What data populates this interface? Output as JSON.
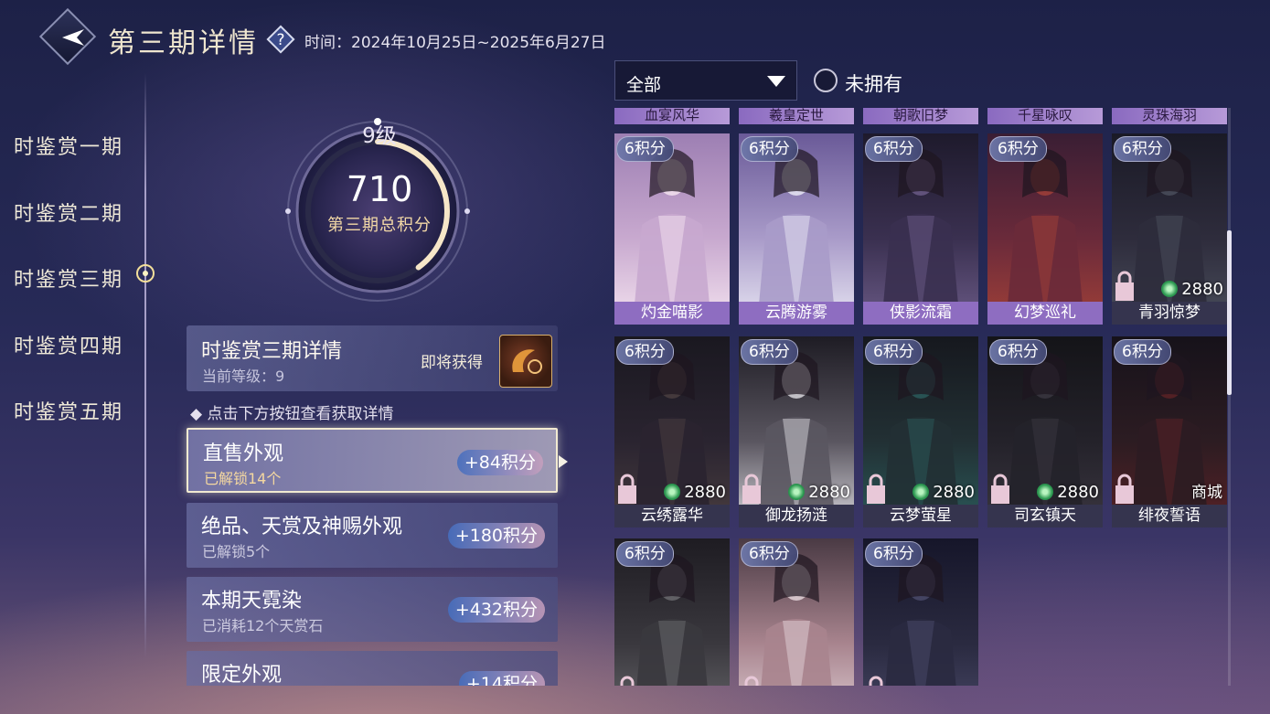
{
  "header": {
    "title": "第三期详情",
    "time_text": "时间：2024年10月25日~2025年6月27日"
  },
  "sidebar": {
    "items": [
      {
        "label": "时鉴赏一期"
      },
      {
        "label": "时鉴赏二期"
      },
      {
        "label": "时鉴赏三期",
        "active": true
      },
      {
        "label": "时鉴赏四期"
      },
      {
        "label": "时鉴赏五期"
      }
    ]
  },
  "progress": {
    "level": "9级",
    "score": "710",
    "label": "第三期总积分",
    "ring_fill_fraction": 0.4
  },
  "detail": {
    "title": "时鉴赏三期详情",
    "current_level": "当前等级：9",
    "soon_label": "即将获得",
    "hint": "◆ 点击下方按钮查看获取详情"
  },
  "rows": [
    {
      "title": "直售外观",
      "sub": "已解锁14个",
      "points": "+84积分",
      "selected": true
    },
    {
      "title": "绝品、天赏及神赐外观",
      "sub": "已解锁5个",
      "points": "+180积分"
    },
    {
      "title": "本期天霓染",
      "sub": "已消耗12个天赏石",
      "points": "+432积分"
    },
    {
      "title": "限定外观",
      "sub": "",
      "points": "+14积分"
    }
  ],
  "filter": {
    "selected": "全部",
    "owned_label": "未拥有"
  },
  "partial_top_row": [
    "血宴风华",
    "羲皇定世",
    "朝歌旧梦",
    "千星咏叹",
    "灵珠海羽"
  ],
  "cards": [
    {
      "name": "灼金喵影",
      "points": "6积分",
      "price": "",
      "shop": "",
      "palette": [
        "#f3e2ef",
        "#c8a9cf",
        "#9d7fb3"
      ],
      "bar": "#8e6dc1"
    },
    {
      "name": "云腾游雾",
      "points": "6积分",
      "price": "",
      "shop": "",
      "palette": [
        "#e8e6f3",
        "#a99bc9",
        "#6a5a98"
      ],
      "bar": "#8e6dc1"
    },
    {
      "name": "侠影流霜",
      "points": "6积分",
      "price": "",
      "shop": "",
      "palette": [
        "#6a5a86",
        "#3a3050",
        "#1e1a2c"
      ],
      "bar": "#8e6dc1"
    },
    {
      "name": "幻梦巡礼",
      "points": "6积分",
      "price": "",
      "shop": "",
      "palette": [
        "#a04038",
        "#6a2a3a",
        "#3a1e34"
      ],
      "bar": "#8e6dc1"
    },
    {
      "name": "青羽惊梦",
      "points": "6积分",
      "price": "2880",
      "shop": "",
      "palette": [
        "#4a4e5c",
        "#2e2c3c",
        "#1a1a26"
      ],
      "bar": "#35344e"
    },
    {
      "name": "云绣露华",
      "points": "6积分",
      "price": "2880",
      "shop": "",
      "palette": [
        "#4a3e40",
        "#2a2430",
        "#1a1820"
      ],
      "bar": "#35344e"
    },
    {
      "name": "御龙扬涟",
      "points": "6积分",
      "price": "2880",
      "shop": "",
      "palette": [
        "#d8d6dc",
        "#5a5660",
        "#1e1c24"
      ],
      "bar": "#35344e"
    },
    {
      "name": "云梦萤星",
      "points": "6积分",
      "price": "2880",
      "shop": "",
      "palette": [
        "#2a5a5a",
        "#223034",
        "#16181e"
      ],
      "bar": "#35344e"
    },
    {
      "name": "司玄镇天",
      "points": "6积分",
      "price": "2880",
      "shop": "",
      "palette": [
        "#3a3640",
        "#24222a",
        "#141418"
      ],
      "bar": "#35344e"
    },
    {
      "name": "绯夜誓语",
      "points": "6积分",
      "price": "",
      "shop": "商城",
      "palette": [
        "#5a2226",
        "#2c1c22",
        "#16121a"
      ],
      "bar": "#35344e"
    },
    {
      "name": "",
      "points": "6积分",
      "price": "",
      "shop": "",
      "palette": [
        "#6a6a6e",
        "#3a383e",
        "#1e1c22"
      ],
      "bar": "#35344e"
    },
    {
      "name": "",
      "points": "6积分",
      "price": "",
      "shop": "",
      "palette": [
        "#e2d2d8",
        "#a8848e",
        "#4a3a44"
      ],
      "bar": "#35344e"
    },
    {
      "name": "",
      "points": "6积分",
      "price": "",
      "shop": "",
      "palette": [
        "#4a4a6a",
        "#2a2a40",
        "#16162a"
      ],
      "bar": "#35344e"
    }
  ],
  "colors": {
    "accent_gold": "#f2d8a6",
    "row_selected_text": "#f5d8a0"
  }
}
